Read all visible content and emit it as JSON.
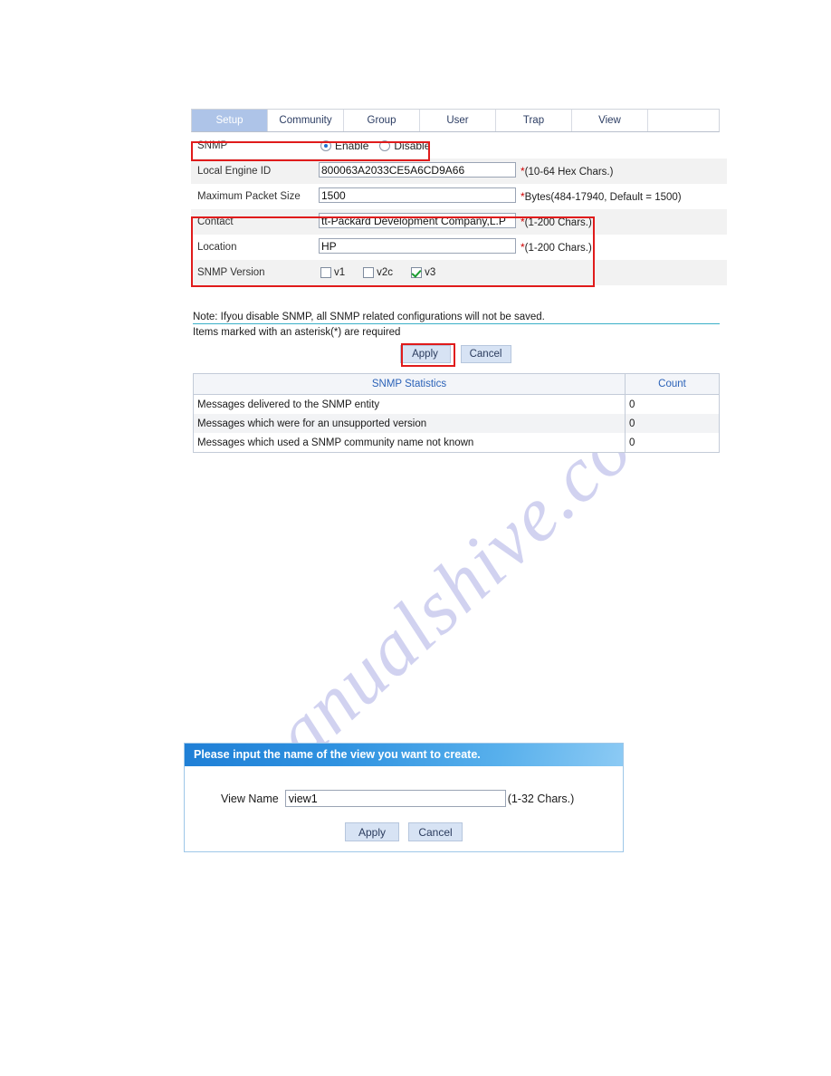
{
  "watermark": {
    "text": "manualshive.com"
  },
  "snmp_panel": {
    "tabs": [
      {
        "label": "Setup",
        "active": true
      },
      {
        "label": "Community",
        "active": false
      },
      {
        "label": "Group",
        "active": false
      },
      {
        "label": "User",
        "active": false
      },
      {
        "label": "Trap",
        "active": false
      },
      {
        "label": "View",
        "active": false
      }
    ],
    "rows": {
      "snmp": {
        "label": "SNMP",
        "enable_label": "Enable",
        "disable_label": "Disable",
        "selected": "Enable"
      },
      "local_engine_id": {
        "label": "Local Engine ID",
        "value": "800063A2033CE5A6CD9A66",
        "hint": "(10-64 Hex Chars.)",
        "required_mark": "*"
      },
      "max_packet_size": {
        "label": "Maximum Packet Size",
        "value": "1500",
        "hint": "Bytes(484-17940, Default = 1500)",
        "required_mark": "*"
      },
      "contact": {
        "label": "Contact",
        "value": "tt-Packard Development Company,L.P",
        "hint": "(1-200 Chars.)",
        "required_mark": "*"
      },
      "location": {
        "label": "Location",
        "value": "HP",
        "hint": "(1-200 Chars.)",
        "required_mark": "*"
      },
      "snmp_version": {
        "label": "SNMP Version",
        "options": [
          {
            "label": "v1",
            "checked": false
          },
          {
            "label": "v2c",
            "checked": false
          },
          {
            "label": "v3",
            "checked": true
          }
        ]
      }
    },
    "notes": {
      "line1": "Note: Ifyou disable SNMP, all SNMP related configurations will not be saved.",
      "line2": "Items marked with an asterisk(*) are required"
    },
    "buttons": {
      "apply": "Apply",
      "cancel": "Cancel"
    },
    "statistics": {
      "headers": [
        "SNMP Statistics",
        "Count"
      ],
      "rows": [
        {
          "name": "Messages delivered to the SNMP entity",
          "count": "0"
        },
        {
          "name": "Messages which were for an unsupported version",
          "count": "0"
        },
        {
          "name": "Messages which used a SNMP community name not known",
          "count": "0"
        }
      ]
    }
  },
  "view_dialog": {
    "title": "Please input the name of the view you want to create.",
    "field_label": "View Name",
    "field_value": "view1",
    "field_placeholder": "",
    "hint": "(1-32 Chars.)",
    "buttons": {
      "apply": "Apply",
      "cancel": "Cancel"
    }
  },
  "colors": {
    "tab_active_bg": "#aec4e8",
    "highlight_red": "#e01b1b",
    "note_rule": "#3ab0c8",
    "dialog_header_blue": "#2f92e0",
    "header_text_blue": "#2b62b8",
    "button_bg": "#d7e3f4"
  }
}
